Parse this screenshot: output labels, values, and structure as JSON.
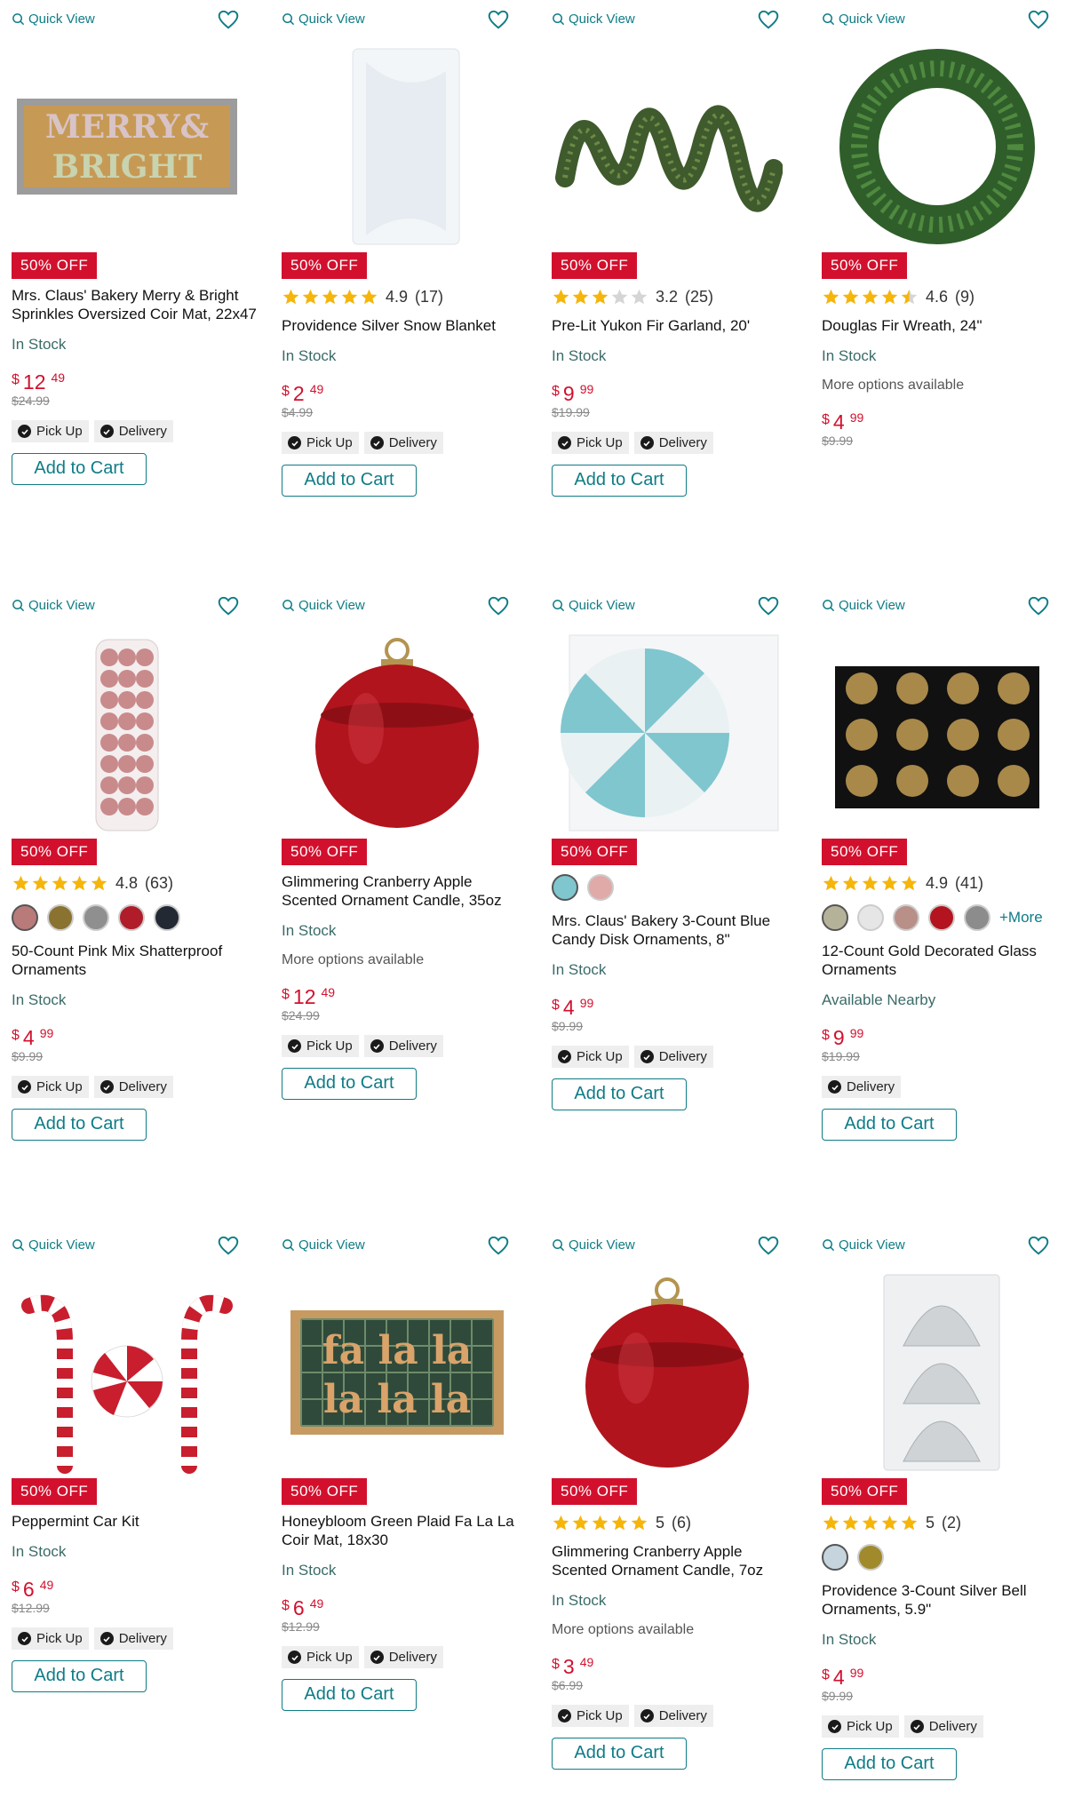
{
  "common": {
    "quick_view": "Quick View",
    "pickup": "Pick Up",
    "delivery": "Delivery",
    "add_to_cart": "Add to Cart",
    "in_stock": "In Stock",
    "more_options": "More options available",
    "badge": "50% OFF",
    "currency": "$"
  },
  "colors": {
    "accent": "#0e7c86",
    "sale": "#d2102d",
    "star": "#f5b50a"
  },
  "products": [
    {
      "title": "Mrs. Claus' Bakery Merry & Bright Sprinkles Oversized Coir Mat, 22x47",
      "rating": null,
      "reviews": null,
      "stock": "In Stock",
      "more_options": false,
      "price_dollars": "12",
      "price_cents": "49",
      "was": "$24.99",
      "pickup": true,
      "delivery": true,
      "cart": true,
      "image": "coir-mat-merry-bright"
    },
    {
      "title": "Providence Silver Snow Blanket",
      "rating": "4.9",
      "reviews": "(17)",
      "stars": 5,
      "stock": "In Stock",
      "more_options": false,
      "price_dollars": "2",
      "price_cents": "49",
      "was": "$4.99",
      "pickup": true,
      "delivery": true,
      "cart": true,
      "image": "snow-blanket"
    },
    {
      "title": "Pre-Lit Yukon Fir Garland, 20'",
      "rating": "3.2",
      "reviews": "(25)",
      "stars": 3,
      "stock": "In Stock",
      "more_options": false,
      "price_dollars": "9",
      "price_cents": "99",
      "was": "$19.99",
      "pickup": true,
      "delivery": true,
      "cart": true,
      "image": "garland"
    },
    {
      "title": "Douglas Fir Wreath, 24\"",
      "rating": "4.6",
      "reviews": "(9)",
      "stars": 4.5,
      "stock": "In Stock",
      "more_options": true,
      "price_dollars": "4",
      "price_cents": "99",
      "was": "$9.99",
      "pickup": false,
      "delivery": false,
      "cart": false,
      "image": "wreath"
    },
    {
      "title": "50-Count Pink Mix Shatterproof Ornaments",
      "rating": "4.8",
      "reviews": "(63)",
      "stars": 5,
      "swatches": [
        "#b97a7a",
        "#8a7230",
        "#8f8f8f",
        "#b01c2a",
        "#222933"
      ],
      "stock": "In Stock",
      "more_options": false,
      "price_dollars": "4",
      "price_cents": "99",
      "was": "$9.99",
      "pickup": true,
      "delivery": true,
      "cart": true,
      "image": "pink-ornaments"
    },
    {
      "title": "Glimmering Cranberry Apple Scented Ornament Candle, 35oz",
      "rating": null,
      "stock": "In Stock",
      "more_options": true,
      "price_dollars": "12",
      "price_cents": "49",
      "was": "$24.99",
      "pickup": true,
      "delivery": true,
      "cart": true,
      "image": "red-candle"
    },
    {
      "title": "Mrs. Claus' Bakery 3-Count Blue Candy Disk Ornaments, 8\"",
      "rating": null,
      "swatches": [
        "#7fc6cf",
        "#e0aaa8"
      ],
      "stock": "In Stock",
      "more_options": false,
      "price_dollars": "4",
      "price_cents": "99",
      "was": "$9.99",
      "pickup": true,
      "delivery": true,
      "cart": true,
      "image": "candy-disk"
    },
    {
      "title": "12-Count Gold Decorated Glass Ornaments",
      "rating": "4.9",
      "reviews": "(41)",
      "stars": 5,
      "swatches": [
        "#b5b29a",
        "#e6e6e6",
        "#b89088",
        "#b3141f",
        "#8c8c8c"
      ],
      "swatch_more": "+More",
      "stock": "Available Nearby",
      "more_options": false,
      "price_dollars": "9",
      "price_cents": "99",
      "was": "$19.99",
      "pickup": false,
      "delivery": true,
      "cart": true,
      "image": "gold-ornaments"
    },
    {
      "title": "Peppermint Car Kit",
      "rating": null,
      "stock": "In Stock",
      "more_options": false,
      "price_dollars": "6",
      "price_cents": "49",
      "was": "$12.99",
      "pickup": true,
      "delivery": true,
      "cart": true,
      "image": "peppermint-kit"
    },
    {
      "title": "Honeybloom Green Plaid Fa La La Coir Mat, 18x30",
      "rating": null,
      "stock": "In Stock",
      "more_options": false,
      "price_dollars": "6",
      "price_cents": "49",
      "was": "$12.99",
      "pickup": true,
      "delivery": true,
      "cart": true,
      "image": "falala-mat"
    },
    {
      "title": "Glimmering Cranberry Apple Scented Ornament Candle, 7oz",
      "rating": "5",
      "reviews": "(6)",
      "stars": 5,
      "stock": "In Stock",
      "more_options": true,
      "price_dollars": "3",
      "price_cents": "49",
      "was": "$6.99",
      "pickup": true,
      "delivery": true,
      "cart": true,
      "image": "red-candle"
    },
    {
      "title": "Providence 3-Count Silver Bell Ornaments, 5.9\"",
      "rating": "5",
      "reviews": "(2)",
      "stars": 5,
      "swatches": [
        "#c6d4dd",
        "#a08a2c"
      ],
      "stock": "In Stock",
      "more_options": false,
      "price_dollars": "4",
      "price_cents": "99",
      "was": "$9.99",
      "pickup": true,
      "delivery": true,
      "cart": true,
      "image": "silver-bells"
    }
  ]
}
